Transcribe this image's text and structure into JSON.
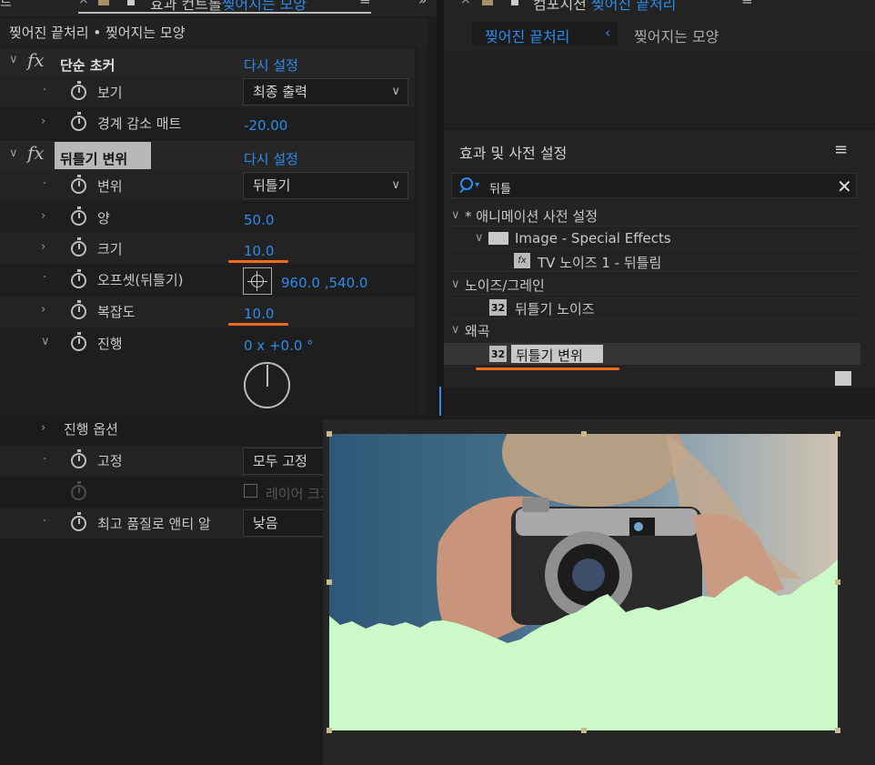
{
  "left_panel": {
    "tab_prefix": "트",
    "tab_label_a": "효과 컨트롤",
    "tab_label_b": "찢어지는 모양",
    "subheader": "찢어진 끝처리 • 찢어지는 모양",
    "effects": [
      {
        "name": "단순 초커",
        "reset": "다시 설정",
        "props": [
          {
            "label": "보기",
            "value": "최종 출력"
          },
          {
            "label": "경계 감소 매트",
            "value": "-20.00"
          }
        ]
      },
      {
        "name": "뒤틀기 변위",
        "reset": "다시 설정",
        "props": [
          {
            "label": "변위",
            "value": "뒤틀기"
          },
          {
            "label": "양",
            "value": "50.0"
          },
          {
            "label": "크기",
            "value": "10.0"
          },
          {
            "label": "오프셋(뒤틀기)",
            "value": "960.0 ,540.0"
          },
          {
            "label": "복잡도",
            "value": "10.0"
          },
          {
            "label": "진행",
            "value": "0 x +0.0 °"
          },
          {
            "label": "진행 옵션",
            "value": ""
          },
          {
            "label": "고정",
            "value": "모두 고정"
          },
          {
            "label": "",
            "value": "레이어 크기"
          },
          {
            "label": "최고 품질로 앤티 알",
            "value": "낮음"
          }
        ]
      }
    ]
  },
  "right_panel": {
    "tab_label_a": "컴포지션",
    "tab_label_b": "찢어진 끝처리",
    "breadcrumb": [
      "찢어진 끝처리",
      "찢어지는 모양"
    ],
    "effects_title": "효과 및 사전 설정",
    "search_value": "뒤틀",
    "tree": [
      {
        "label": "* 애니메이션 사전 설정",
        "level": 0
      },
      {
        "label": "Image - Special Effects",
        "level": 1
      },
      {
        "label": "TV 노이즈 1 - 뒤틀림",
        "level": 2
      },
      {
        "label": "노이즈/그레인",
        "level": 0
      },
      {
        "label": "뒤틀기 노이즈",
        "level": 1
      },
      {
        "label": "왜곡",
        "level": 0
      },
      {
        "label": "뒤틀기 변위",
        "level": 1
      }
    ]
  },
  "colors": {
    "accent_blue": "#2d8ceb",
    "highlight_orange": "#f36b1c",
    "mint_fill": "#ccf9c8"
  },
  "icons": [
    "fx-icon",
    "stopwatch-icon",
    "chevron-icon",
    "search-icon",
    "close-icon",
    "folder-icon",
    "menu-icon"
  ]
}
